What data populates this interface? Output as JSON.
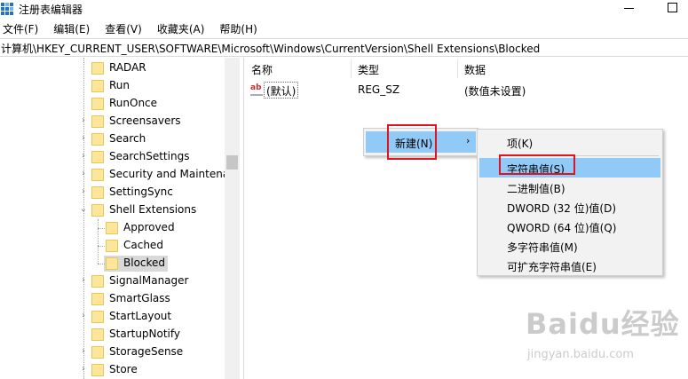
{
  "window": {
    "title": "注册表编辑器"
  },
  "menu": [
    "文件(F)",
    "编辑(E)",
    "查看(V)",
    "收藏夹(A)",
    "帮助(H)"
  ],
  "address": "计算机\\HKEY_CURRENT_USER\\SOFTWARE\\Microsoft\\Windows\\CurrentVersion\\Shell Extensions\\Blocked",
  "tree": {
    "items": [
      {
        "label": "RADAR",
        "level": 0,
        "expandable": false
      },
      {
        "label": "Run",
        "level": 0,
        "expandable": false
      },
      {
        "label": "RunOnce",
        "level": 0,
        "expandable": false
      },
      {
        "label": "Screensavers",
        "level": 0,
        "expandable": true
      },
      {
        "label": "Search",
        "level": 0,
        "expandable": true
      },
      {
        "label": "SearchSettings",
        "level": 0,
        "expandable": true
      },
      {
        "label": "Security and Maintena",
        "level": 0,
        "expandable": true
      },
      {
        "label": "SettingSync",
        "level": 0,
        "expandable": true
      },
      {
        "label": "Shell Extensions",
        "level": 0,
        "expandable": true,
        "expanded": true
      },
      {
        "label": "Approved",
        "level": 1,
        "expandable": false
      },
      {
        "label": "Cached",
        "level": 1,
        "expandable": false
      },
      {
        "label": "Blocked",
        "level": 1,
        "expandable": false,
        "selected": true
      },
      {
        "label": "SignalManager",
        "level": 0,
        "expandable": true
      },
      {
        "label": "SmartGlass",
        "level": 0,
        "expandable": false
      },
      {
        "label": "StartLayout",
        "level": 0,
        "expandable": true
      },
      {
        "label": "StartupNotify",
        "level": 0,
        "expandable": false
      },
      {
        "label": "StorageSense",
        "level": 0,
        "expandable": true
      },
      {
        "label": "Store",
        "level": 0,
        "expandable": true
      }
    ]
  },
  "list": {
    "headers": {
      "name": "名称",
      "type": "类型",
      "data": "数据"
    },
    "rows": [
      {
        "icon": "ab",
        "name": "(默认)",
        "type": "REG_SZ",
        "data": "(数值未设置)"
      }
    ]
  },
  "context_menu": {
    "new_label": "新建(N)",
    "arrow": "›"
  },
  "submenu": {
    "items": [
      "项(K)",
      "字符串值(S)",
      "二进制值(B)",
      "DWORD (32 位)值(D)",
      "QWORD (64 位)值(Q)",
      "多字符串值(M)",
      "可扩充字符串值(E)"
    ],
    "highlighted": "字符串值(S)"
  },
  "watermark": {
    "main": "Baidu经验",
    "sub": "jingyan.baidu.com"
  },
  "colors": {
    "highlight": "#91c9f7",
    "annotation": "#e0141e",
    "folder": "#fce69a",
    "selected_row": "#d9d9d9"
  }
}
